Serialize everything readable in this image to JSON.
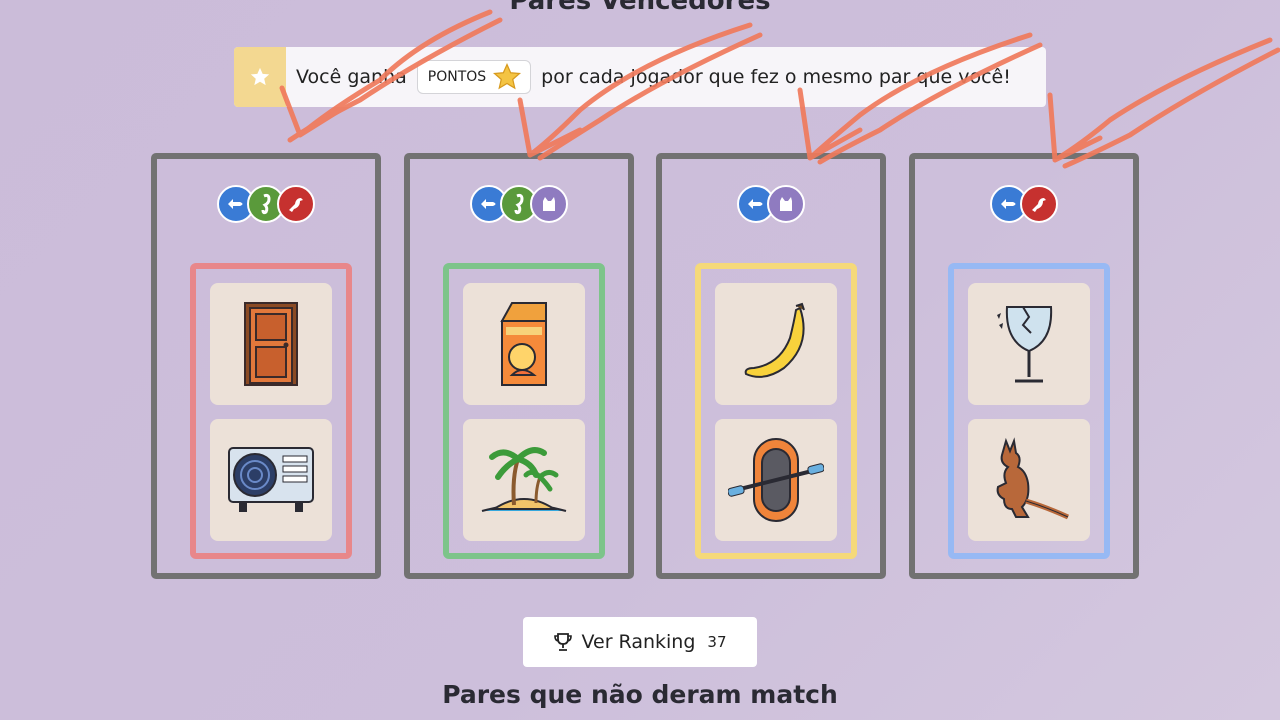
{
  "header": {
    "title": "Pares Vencedores"
  },
  "banner": {
    "text_before": "Você ganha",
    "points_label": "PONTOS",
    "text_after": "por cada jogador que fez o mesmo par que você!",
    "icon": "star-icon"
  },
  "pairs": [
    {
      "border_color": "#e8878a",
      "players": [
        "fish",
        "seahorse",
        "bird"
      ],
      "items": [
        "door",
        "air-conditioner"
      ]
    },
    {
      "border_color": "#7dc48a",
      "players": [
        "fish",
        "seahorse",
        "cat"
      ],
      "items": [
        "juice-carton",
        "palm-island"
      ]
    },
    {
      "border_color": "#f5d97a",
      "players": [
        "fish",
        "cat"
      ],
      "items": [
        "banana",
        "raft"
      ]
    },
    {
      "border_color": "#97b9f4",
      "players": [
        "fish",
        "bird"
      ],
      "items": [
        "broken-glass",
        "kangaroo"
      ]
    }
  ],
  "player_colors": {
    "fish": "#3a7bd5",
    "seahorse": "#5a9a3b",
    "bird": "#c6312f",
    "cat": "#8f7bc0"
  },
  "ranking_button": {
    "label": "Ver Ranking",
    "count": "37",
    "icon": "trophy-icon"
  },
  "footer": {
    "subtitle": "Pares que não deram match"
  }
}
